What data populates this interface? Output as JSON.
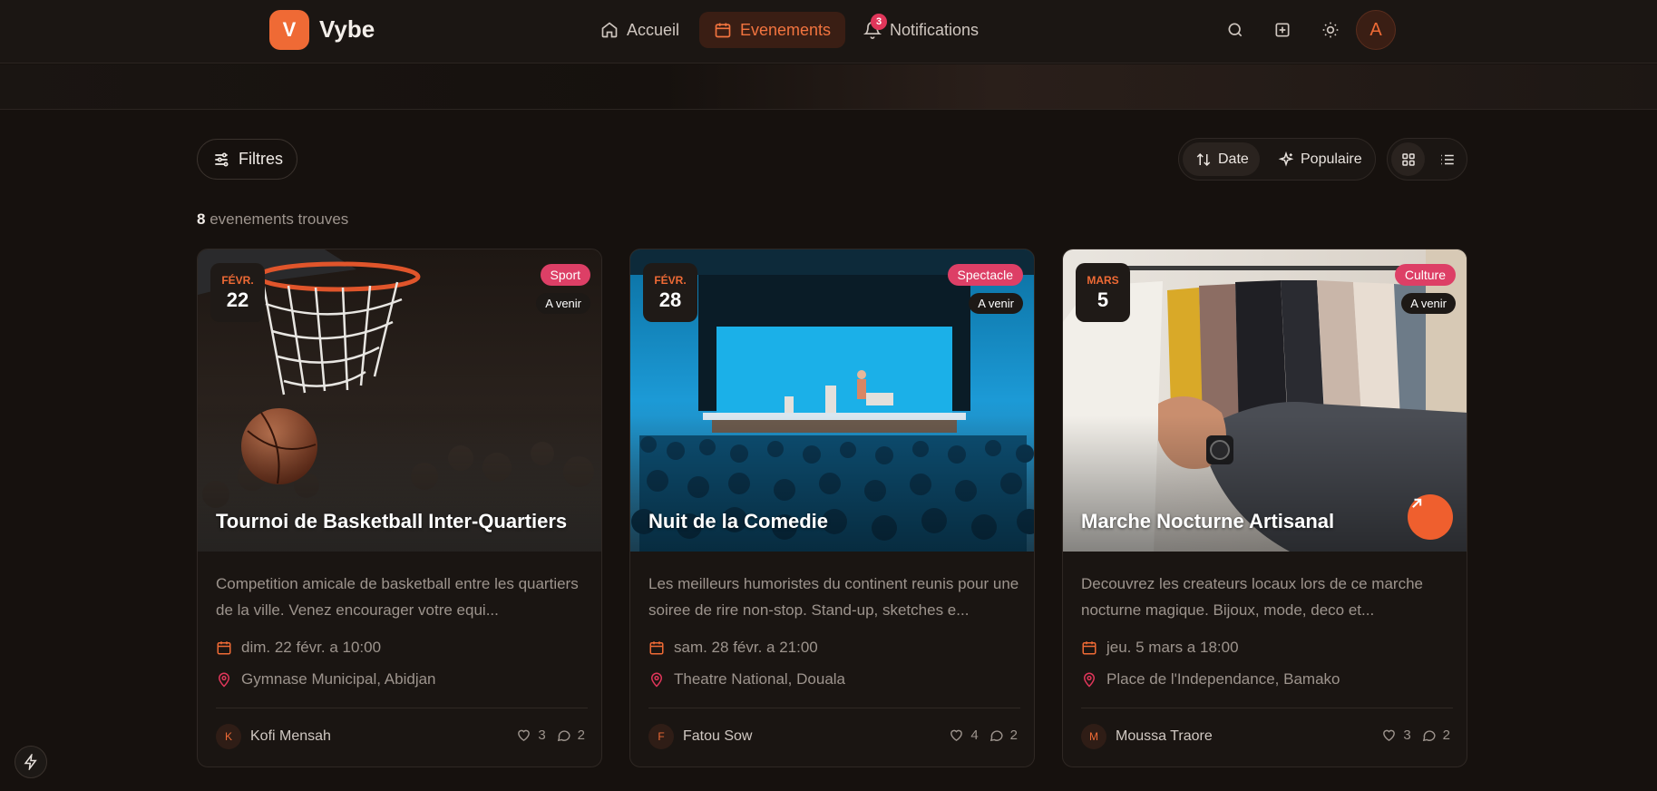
{
  "app": {
    "logo_letter": "V",
    "name": "Vybe",
    "accent": "#ef6a35"
  },
  "nav": {
    "home": "Accueil",
    "events": "Evenements",
    "notifications": "Notifications",
    "notif_count": "3"
  },
  "header_actions": {
    "avatar_letter": "A",
    "icons": [
      "search-icon",
      "plus-square-icon",
      "sun-icon"
    ]
  },
  "toolbar": {
    "filters": "Filtres",
    "sort_date": "Date",
    "sort_popular": "Populaire",
    "view_modes": [
      "grid-icon",
      "list-icon"
    ]
  },
  "results": {
    "count": "8",
    "label": "evenements trouves"
  },
  "events": [
    {
      "month": "FÉVR.",
      "day": "22",
      "category": "Sport",
      "status": "A venir",
      "title": "Tournoi de Basketball Inter-Quartiers",
      "description": "Competition amicale de basketball entre les quartiers de la ville. Venez encourager votre equi...",
      "datetime": "dim. 22 févr. a 10:00",
      "location": "Gymnase Municipal, Abidjan",
      "author_initial": "K",
      "author": "Kofi Mensah",
      "likes": "3",
      "comments": "2"
    },
    {
      "month": "FÉVR.",
      "day": "28",
      "category": "Spectacle",
      "status": "A venir",
      "title": "Nuit de la Comedie",
      "description": "Les meilleurs humoristes du continent reunis pour une soiree de rire non-stop. Stand-up, sketches e...",
      "datetime": "sam. 28 févr. a 21:00",
      "location": "Theatre National, Douala",
      "author_initial": "F",
      "author": "Fatou Sow",
      "likes": "4",
      "comments": "2"
    },
    {
      "month": "MARS",
      "day": "5",
      "category": "Culture",
      "status": "A venir",
      "title": "Marche Nocturne Artisanal",
      "description": "Decouvrez les createurs locaux lors de ce marche nocturne magique. Bijoux, mode, deco et...",
      "datetime": "jeu. 5 mars a 18:00",
      "location": "Place de l'Independance, Bamako",
      "author_initial": "M",
      "author": "Moussa Traore",
      "likes": "3",
      "comments": "2"
    }
  ]
}
